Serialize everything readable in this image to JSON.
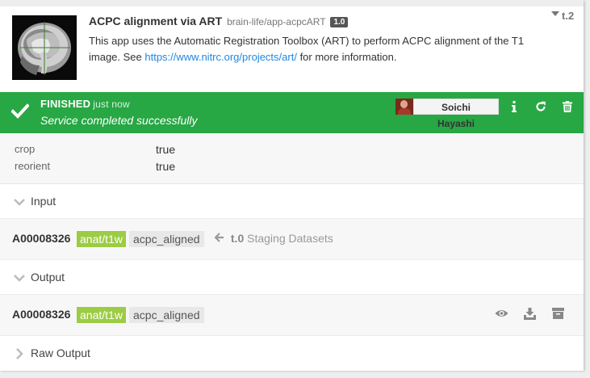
{
  "app": {
    "title": "ACPC alignment via ART",
    "repo": "brain-life/app-acpcART",
    "version": "1.0",
    "description_pre": "This app uses the Automatic Registration Toolbox (ART) to perform ACPC alignment of the T1 image. See ",
    "link": "https://www.nitrc.org/projects/art/",
    "description_post": " for more information.",
    "tag": "t.2"
  },
  "status": {
    "state": "FINISHED",
    "when": "just now",
    "message": "Service completed successfully",
    "user": "Soichi Hayashi",
    "color": "#28a745"
  },
  "config": [
    {
      "key": "crop",
      "value": "true"
    },
    {
      "key": "reorient",
      "value": "true"
    }
  ],
  "input": {
    "label": "Input",
    "subject": "A00008326",
    "datatype": "anat/t1w",
    "datatype_tag": "acpc_aligned",
    "from_task": "t.0",
    "from_label": "Staging Datasets"
  },
  "output": {
    "label": "Output",
    "subject": "A00008326",
    "datatype": "anat/t1w",
    "datatype_tag": "acpc_aligned"
  },
  "raw_output": {
    "label": "Raw Output"
  },
  "icons": {
    "finished": "check-icon",
    "info": "info-icon",
    "rerun": "refresh-icon",
    "delete": "trash-icon",
    "view": "eye-icon",
    "download": "download-icon",
    "archive": "archive-icon"
  }
}
